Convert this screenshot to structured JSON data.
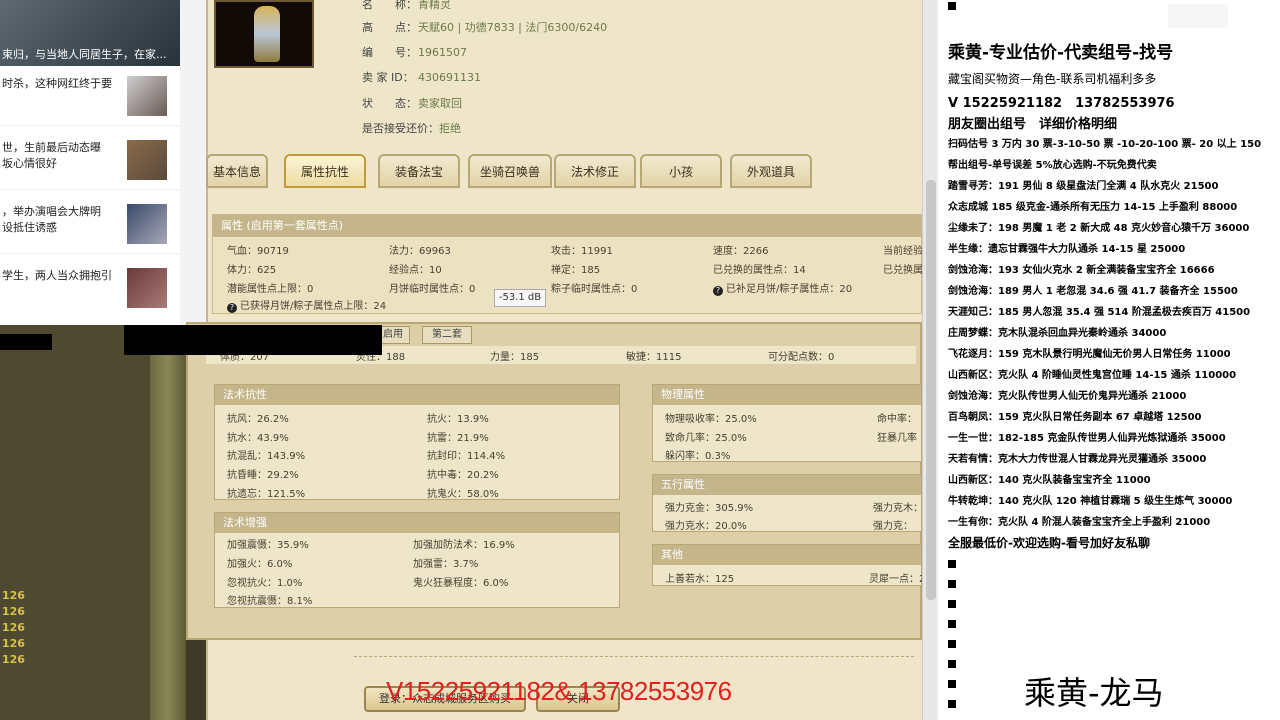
{
  "news": {
    "items": [
      {
        "text": "束归，与当地人同居生子，在家..."
      },
      {
        "text": "时杀，这种网红终于要"
      },
      {
        "text": "世，生前最后动态曝\n坂心情很好"
      },
      {
        "text": "，举办演唱会大牌明\n设抵住诱惑"
      },
      {
        "text": "学生，两人当众拥抱引"
      }
    ]
  },
  "left_numbers": [
    "126",
    "126",
    "126",
    "126",
    "126"
  ],
  "profile": {
    "rows": [
      {
        "label": "名　　称：",
        "value": "青精灵"
      },
      {
        "label": "高　　点：",
        "value": "天赋60 | 功德7833 | 法门6300/6240"
      },
      {
        "label": "编　　号：",
        "value": "1961507"
      },
      {
        "label": "卖 家 ID：",
        "value": "430691131"
      },
      {
        "label": "状　　态：",
        "value": "卖家取回"
      },
      {
        "label": "是否接受还价：",
        "value": "拒绝"
      }
    ]
  },
  "tabs": [
    "基本信息",
    "属性抗性",
    "装备法宝",
    "坐骑召唤兽",
    "法术修正",
    "小孩",
    "外观道具"
  ],
  "attr_panel": {
    "header": "属性 (启用第一套属性点)",
    "cells": [
      "气血：90719",
      "法力：69963",
      "攻击：11991",
      "速度：2266",
      "当前经验",
      "体力：625",
      "经验点：10",
      "禅定：185",
      "已兑换的属性点：14",
      "已兑换属",
      "潜能属性点上限：0",
      "月饼临时属性点：0",
      "粽子临时属性点：0",
      "已补足月饼/粽子属性点：20",
      "已获得月饼/粽子属性点上限：24"
    ]
  },
  "tooltip": "-53.1 dB",
  "subtabs": [
    "启用",
    "第二套"
  ],
  "base_row": [
    "体质：207",
    "灵性：188",
    "力量：185",
    "敏捷：1115",
    "可分配点数：0"
  ],
  "magic_resist": {
    "title": "法术抗性",
    "cells": [
      "抗风：26.2%",
      "抗火：13.9%",
      "抗水：43.9%",
      "抗雷：21.9%",
      "抗混乱：143.9%",
      "抗封印：114.4%",
      "抗昏睡：29.2%",
      "抗中毒：20.2%",
      "抗遗忘：121.5%",
      "抗鬼火：58.0%"
    ]
  },
  "magic_boost": {
    "title": "法术增强",
    "cells": [
      "加强震慑：35.9%",
      "加强加防法术：16.9%",
      "加强火：6.0%",
      "加强雷：3.7%",
      "忽视抗火：1.0%",
      "鬼火狂暴程度：6.0%",
      "忽视抗震慑：8.1%"
    ]
  },
  "physical": {
    "title": "物理属性",
    "cells": [
      "物理吸收率：25.0%",
      "命中率：",
      "致命几率：25.0%",
      "狂暴几率",
      "躲闪率：0.3%"
    ]
  },
  "wuxing": {
    "title": "五行属性",
    "cells": [
      "强力克金：305.9%",
      "强力克木：",
      "强力克水：20.0%",
      "强力克："
    ]
  },
  "other": {
    "title": "其他",
    "cells": [
      "上善若水：125",
      "灵犀一点：2"
    ]
  },
  "actions": [
    "登录：众志成城服务区购买",
    "关闭"
  ],
  "overlay_phone": "V15225921182& 13782553976",
  "ad": {
    "title": "乘黄-专业估价-代卖组号-找号",
    "lines": [
      "藏宝阁买物资—角色-联系司机福利多多",
      "V 15225921182　13782553976",
      "朋友圈出组号　详细价格明细",
      "扫码估号 3 万内 30 票-3-10-50 票 -10-20-100 票- 20 以上 150",
      "帮出组号-单号误差 5%放心选购-不玩免费代卖",
      "踏雪寻芳：191 男仙 8 级星盘法门全满 4 队水克火 21500",
      "众志成城 185 级克金-通杀所有无压力 14-15 上手盈利 88000",
      "尘缘未了：198 男魔 1 老 2 新大成 48 克火妙音心猿千万 36000",
      "半生缘：遗忘甘霖强牛大力队通杀 14-15 星 25000",
      "剑蚀沧海：193 女仙火克水 2 新全满装备宝宝齐全 16666",
      "剑蚀沧海：189 男人 1 老忽混 34.6 强 41.7 装备齐全 15500",
      "天涯知己：185 男人忽混 35.4 强 514 阶混孟极去疾百万 41500",
      "庄周梦蝶：克木队混杀回血异光秦岭通杀 34000",
      "飞花逐月：159 克木队景行明光魔仙无价男人日常任务 11000",
      "山西新区：克火队 4 阶睡仙灵性鬼宫位睡 14-15 通杀 110000",
      "剑蚀沧海：克火队传世男人仙无价鬼异光通杀 21000",
      "百鸟朝凤：159 克火队日常任务副本 67 卓越塔 12500",
      "一生一世：182-185 克金队传世男人仙异光炼狱通杀 35000",
      "天若有情：克木大力传世混人甘霖龙异光灵獾通杀 35000",
      "山西新区：140 克火队装备宝宝齐全 11000",
      "牛转乾坤：140 克火队 120 神植甘霖瑞 5 级生生炼气 30000",
      "一生有你：克火队 4 阶混人装备宝宝齐全上手盈利 21000",
      "全服最低价-欢迎选购-看号加好友私聊"
    ],
    "logo": "乘黄-龙马"
  }
}
